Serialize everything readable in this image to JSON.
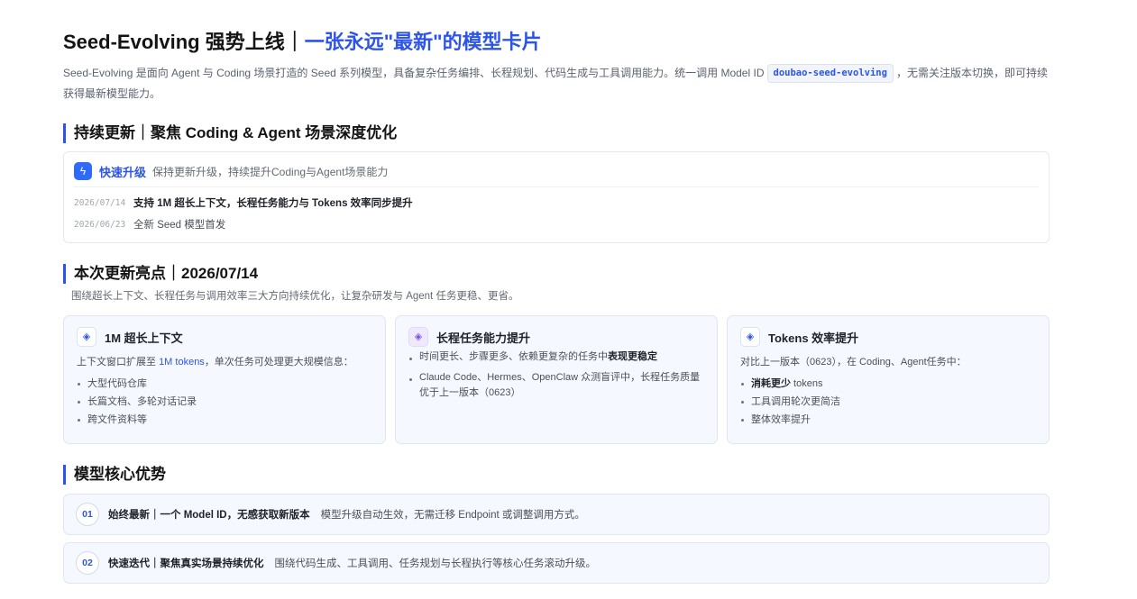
{
  "header": {
    "title_main": "Seed-Evolving 强势上线｜",
    "title_accent": "一张永远\"最新\"的模型卡片",
    "intro_before": "Seed-Evolving 是面向 Agent 与 Coding 场景打造的 Seed 系列模型，具备复杂任务编排、长程规划、代码生成与工具调用能力。统一调用 Model ID",
    "model_id": "doubao-seed-evolving",
    "intro_after": "，无需关注版本切换，即可持续获得最新模型能力。"
  },
  "continuous": {
    "title": "持续更新｜聚焦 Coding & Agent 场景深度优化",
    "badge_name": "快速升级",
    "badge_desc": "保持更新升级，持续提升Coding与Agent场景能力",
    "logs": [
      {
        "date": "2026/07/14",
        "text": "支持 1M 超长上下文，长程任务能力与 Tokens 效率同步提升"
      },
      {
        "date": "2026/06/23",
        "text": "全新 Seed 模型首发"
      }
    ]
  },
  "highlights": {
    "title": "本次更新亮点｜2026/07/14",
    "subtitle": "围绕超长上下文、长程任务与调用效率三大方向持续优化，让复杂研发与 Agent 任务更稳、更省。",
    "cards": [
      {
        "title": "1M 超长上下文",
        "lead_before": "上下文窗口扩展至 ",
        "lead_highlight": "1M tokens",
        "lead_after": "，单次任务可处理更大规模信息：",
        "items": [
          "大型代码仓库",
          "长篇文档、多轮对话记录",
          "跨文件资料等"
        ]
      },
      {
        "title": "长程任务能力提升",
        "item1_before": "时间更长、步骤更多、依赖更复杂的任务中",
        "item1_bold": "表现更稳定",
        "item2": "Claude Code、Hermes、OpenClaw 众测盲评中，长程任务质量优于上一版本（0623）"
      },
      {
        "title": "Tokens 效率提升",
        "lead": "对比上一版本（0623），在 Coding、Agent任务中：",
        "item1_bold": "消耗更少",
        "item1_rest": " tokens",
        "items_rest": [
          "工具调用轮次更简洁",
          "整体效率提升"
        ]
      }
    ]
  },
  "advantages": {
    "title": "模型核心优势",
    "items": [
      {
        "num": "01",
        "title": "始终最新｜一个 Model ID，无感获取新版本",
        "desc": "模型升级自动生效，无需迁移 Endpoint 或调整调用方式。"
      },
      {
        "num": "02",
        "title": "快速迭代｜聚焦真实场景持续优化",
        "desc": "围绕代码生成、工具调用、任务规划与长程执行等核心任务滚动升级。"
      }
    ]
  },
  "icons": {
    "bolt": "lightning-bolt-icon",
    "feature": "diamond-icon"
  },
  "colors": {
    "accent": "#2c55e8",
    "card_bg": "#f5f8fe",
    "purple": "#7b4fe8"
  }
}
